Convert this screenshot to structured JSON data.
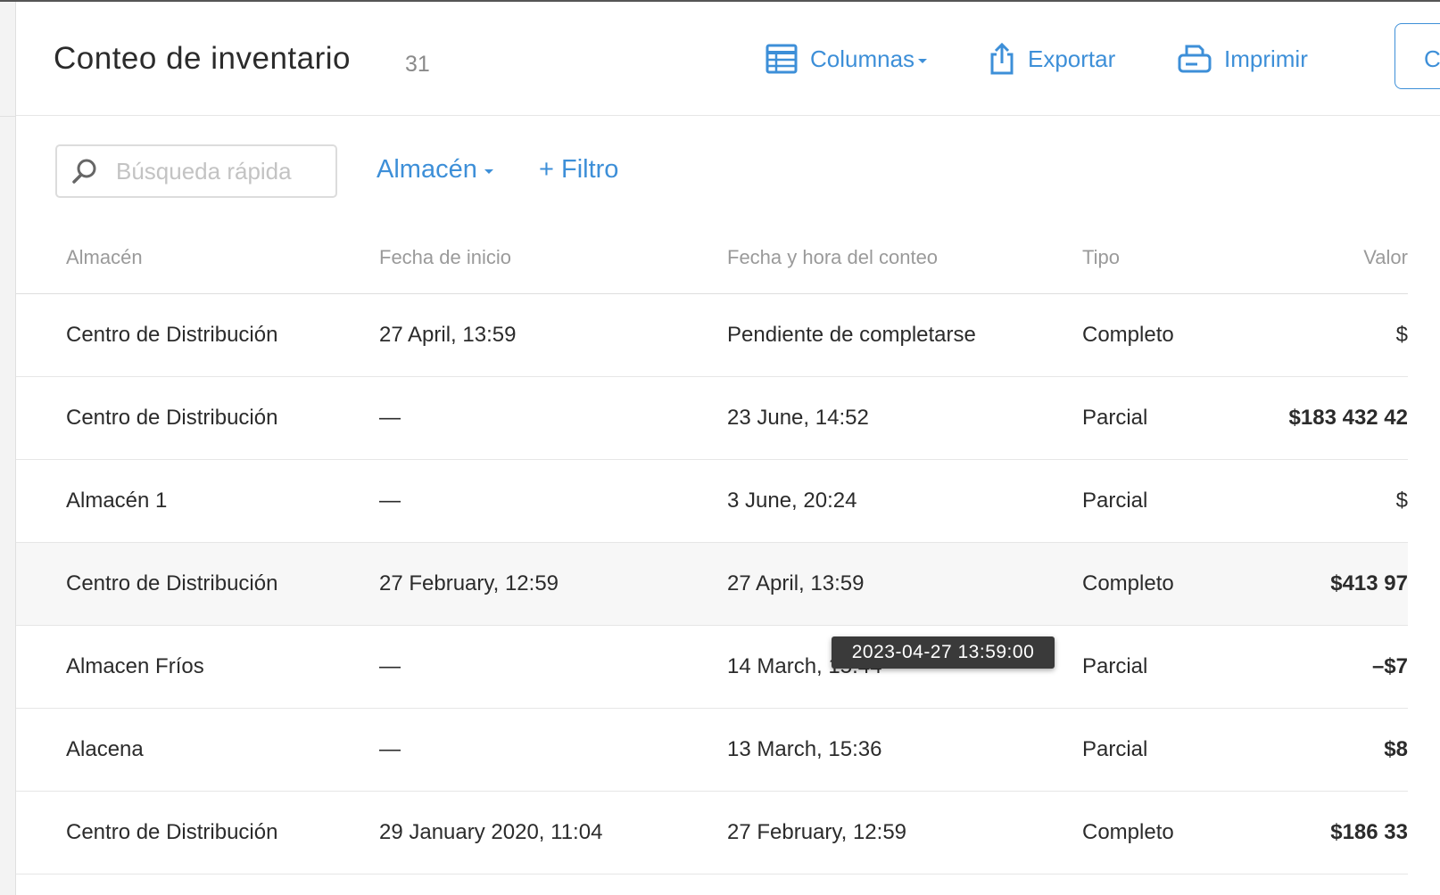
{
  "header": {
    "title": "Conteo de inventario",
    "count": "31",
    "columns_label": "Columnas",
    "export_label": "Exportar",
    "print_label": "Imprimir",
    "edge_button_label": "C"
  },
  "toolbar": {
    "search_placeholder": "Búsqueda rápida",
    "warehouse_filter_label": "Almacén",
    "add_filter_label": "+ Filtro"
  },
  "table": {
    "columns": [
      "Almacén",
      "Fecha de inicio",
      "Fecha y hora del conteo",
      "Tipo",
      "Valor"
    ],
    "rows": [
      {
        "warehouse": "Centro de Distribución",
        "start_date": "27 April, 13:59",
        "count_datetime": "Pendiente de completarse",
        "type": "Completo",
        "value": "$"
      },
      {
        "warehouse": "Centro de Distribución",
        "start_date": "—",
        "count_datetime": "23 June, 14:52",
        "type": "Parcial",
        "value": "$183 432 42"
      },
      {
        "warehouse": "Almacén 1",
        "start_date": "—",
        "count_datetime": "3 June, 20:24",
        "type": "Parcial",
        "value": "$"
      },
      {
        "warehouse": "Centro de Distribución",
        "start_date": "27 February, 12:59",
        "count_datetime": "27 April, 13:59",
        "type": "Completo",
        "value": "$413 97"
      },
      {
        "warehouse": "Almacen Fríos",
        "start_date": "—",
        "count_datetime": "14 March, 15:44",
        "type": "Parcial",
        "value": "–$7"
      },
      {
        "warehouse": "Alacena",
        "start_date": "—",
        "count_datetime": "13 March, 15:36",
        "type": "Parcial",
        "value": "$8"
      },
      {
        "warehouse": "Centro de Distribución",
        "start_date": "29 January 2020, 11:04",
        "count_datetime": "27 February, 12:59",
        "type": "Completo",
        "value": "$186 33"
      }
    ]
  },
  "tooltip": {
    "text": "2023-04-27 13:59:00"
  },
  "colors": {
    "accent": "#3d8fd8",
    "negative": "#d64545",
    "tooltip_bg": "#3a3a3a"
  },
  "icons": {
    "columns": "table-grid-icon",
    "export": "share-upload-icon",
    "print": "printer-icon",
    "search": "magnifier-icon"
  }
}
